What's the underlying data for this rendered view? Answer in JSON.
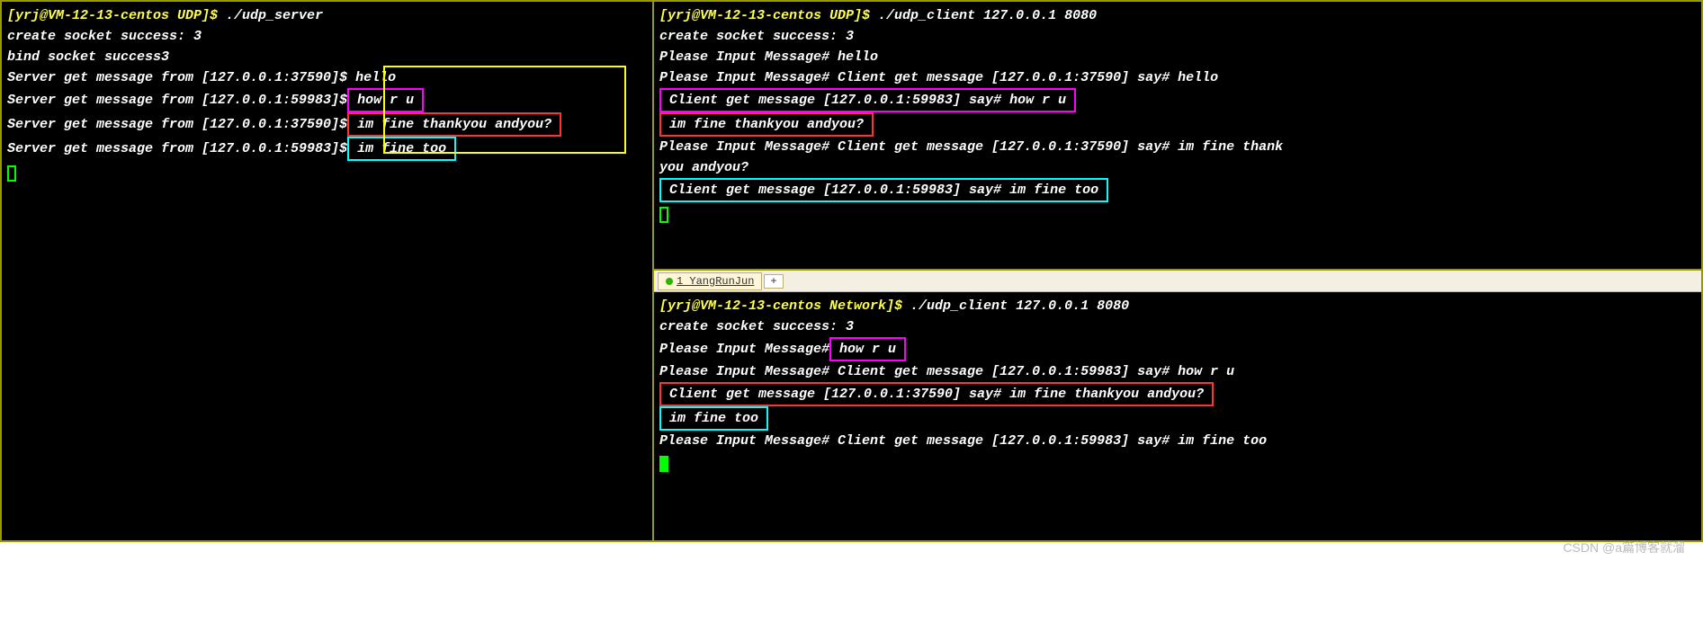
{
  "left": {
    "prompt": "[yrj@VM-12-13-centos UDP]$ ",
    "cmd": "./udp_server",
    "l1": "create socket success: 3",
    "l2": "bind socket success3",
    "from1": "Server get message from [127.0.0.1:37590]$",
    "from2": "Server get message from [127.0.0.1:59983]$",
    "msg1": " hello",
    "msg2": " how r u ",
    "msg3": " im fine thankyou andyou? ",
    "msg4": " im fine too "
  },
  "rt": {
    "prompt": "[yrj@VM-12-13-centos UDP]$ ",
    "cmd": "./udp_client 127.0.0.1 8080",
    "l1": "create socket success: 3",
    "l2": "Please Input Message# hello",
    "l3": "Please Input Message# Client get message [127.0.0.1:37590] say# hello",
    "l4": " Client get message [127.0.0.1:59983] say# how r u ",
    "l5": " im fine thankyou andyou? ",
    "l6a": "Please Input Message# Client get message [127.0.0.1:37590] say# im fine thank",
    "l6b": "you andyou?",
    "l7": " Client get message [127.0.0.1:59983] say# im fine too "
  },
  "tab": {
    "label": "1 YangRunJun",
    "add": "+"
  },
  "rb": {
    "prompt": "[yrj@VM-12-13-centos Network]$ ",
    "cmd": "./udp_client 127.0.0.1 8080",
    "l1": "create socket success: 3",
    "l2a": "Please Input Message#",
    "l2b": " how r u ",
    "l3": "Please Input Message# Client get message [127.0.0.1:59983] say# how r u",
    "l4": " Client get message [127.0.0.1:37590] say# im fine thankyou andyou? ",
    "l5": " im fine too ",
    "l6": "Please Input Message# Client get message [127.0.0.1:59983] say# im fine too"
  },
  "watermark": "CSDN @a篇博客就溜"
}
